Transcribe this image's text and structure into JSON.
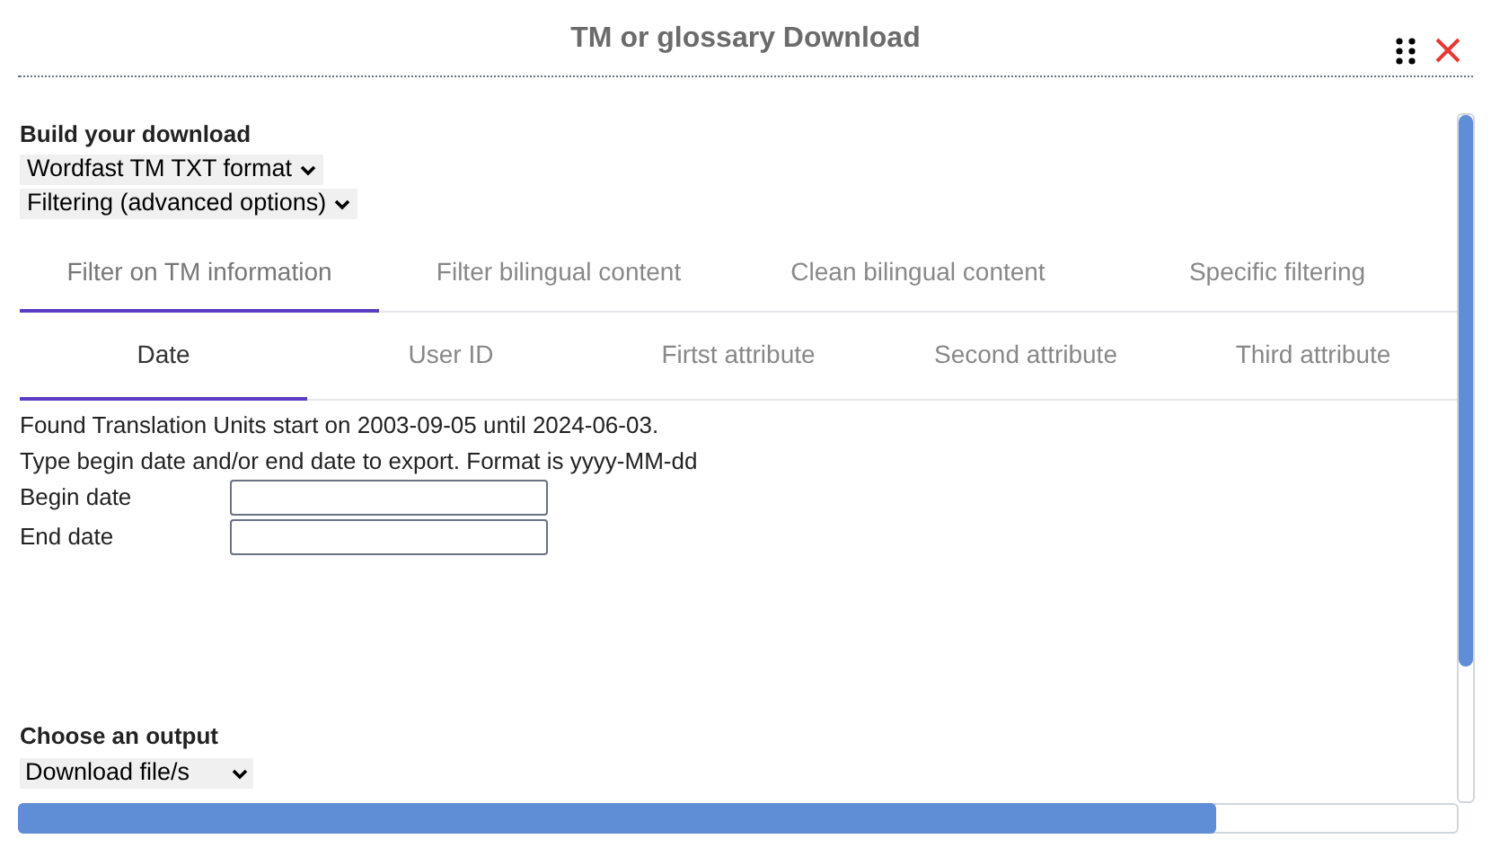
{
  "window": {
    "title": "TM or glossary Download"
  },
  "build": {
    "heading": "Build your download",
    "format_select": "Wordfast TM TXT format",
    "filter_select": "Filtering (advanced options)"
  },
  "tabs": [
    {
      "label": "Filter on TM information",
      "selected": true
    },
    {
      "label": "Filter bilingual content",
      "selected": false
    },
    {
      "label": "Clean bilingual content",
      "selected": false
    },
    {
      "label": "Specific filtering",
      "selected": false
    }
  ],
  "subtabs": [
    {
      "label": "Date",
      "selected": true
    },
    {
      "label": "User ID",
      "selected": false
    },
    {
      "label": "Firtst attribute",
      "selected": false
    },
    {
      "label": "Second attribute",
      "selected": false
    },
    {
      "label": "Third attribute",
      "selected": false
    }
  ],
  "info": [
    "Found Translation Units start on 2003-09-05 until 2024-06-03.",
    "Type begin date and/or end date to export. Format is yyyy-MM-dd"
  ],
  "fields": [
    {
      "label": "Begin date"
    },
    {
      "label": "End date"
    }
  ],
  "output": {
    "heading": "Choose an output",
    "select": "Download file/s"
  }
}
